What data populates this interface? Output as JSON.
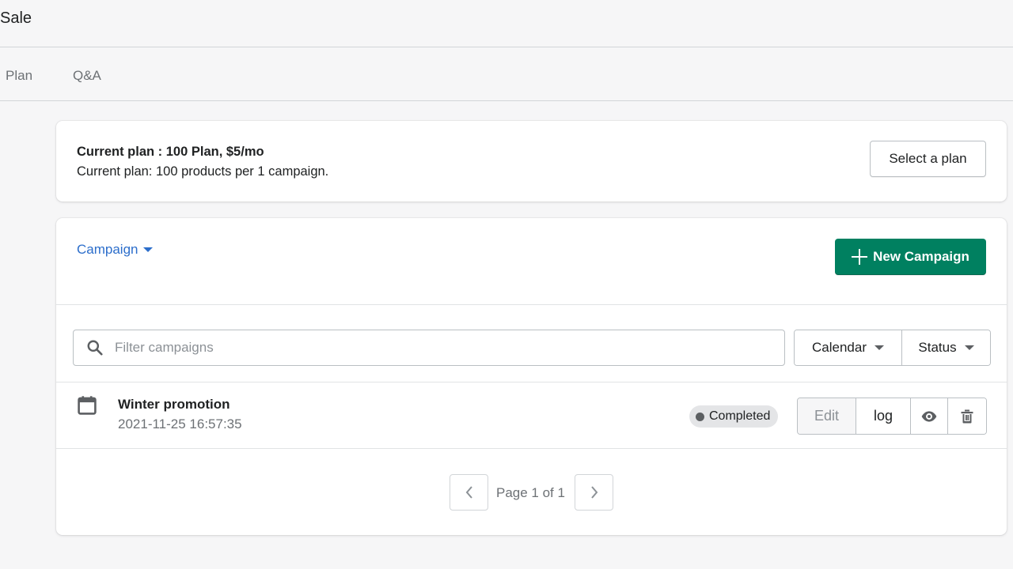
{
  "app": {
    "title": "Sale"
  },
  "tabs": [
    {
      "label": "Plan"
    },
    {
      "label": "Q&A"
    }
  ],
  "plan_card": {
    "title": "Current plan : 100 Plan, $5/mo",
    "description": "Current plan: 100 products per 1 campaign.",
    "select_button": "Select a plan"
  },
  "campaign_card": {
    "dropdown_label": "Campaign",
    "new_button": "New Campaign",
    "search": {
      "placeholder": "Filter campaigns",
      "value": ""
    },
    "filters": [
      {
        "label": "Calendar"
      },
      {
        "label": "Status"
      }
    ],
    "campaigns": [
      {
        "name": "Winter promotion",
        "date": "2021-11-25 16:57:35",
        "status": "Completed",
        "actions": {
          "edit": "Edit",
          "log": "log"
        }
      }
    ],
    "pagination": {
      "label": "Page 1 of 1"
    }
  },
  "colors": {
    "primary": "#008060",
    "link": "#2c6ecb",
    "background": "#f6f6f7"
  }
}
